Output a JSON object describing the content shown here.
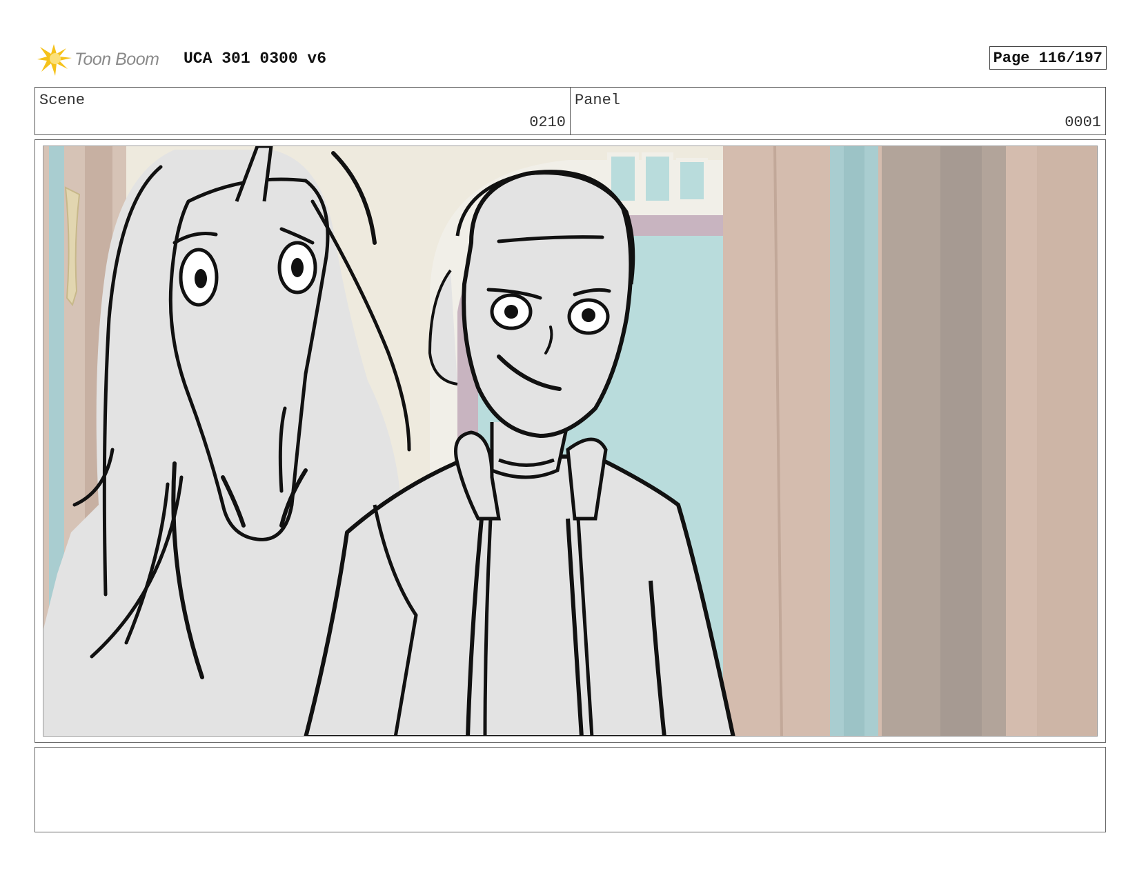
{
  "header": {
    "logo_text": "Toon Boom",
    "title": "UCA 301 0300 v6",
    "page_label": "Page 116/197"
  },
  "info": {
    "scene_label": "Scene",
    "scene_value": "0210",
    "panel_label": "Panel",
    "panel_value": "0001"
  },
  "panel": {
    "image": "storyboard-sketch: unicorn and smiling boy in front of window and curtains"
  },
  "notes": {
    "text": ""
  },
  "colors": {
    "logo_yellow": "#f5c21b",
    "curtain": "#cdb5a6",
    "window_glass": "#b9dcdc",
    "sketch_fill": "#e3e3e3",
    "line": "#111111"
  }
}
